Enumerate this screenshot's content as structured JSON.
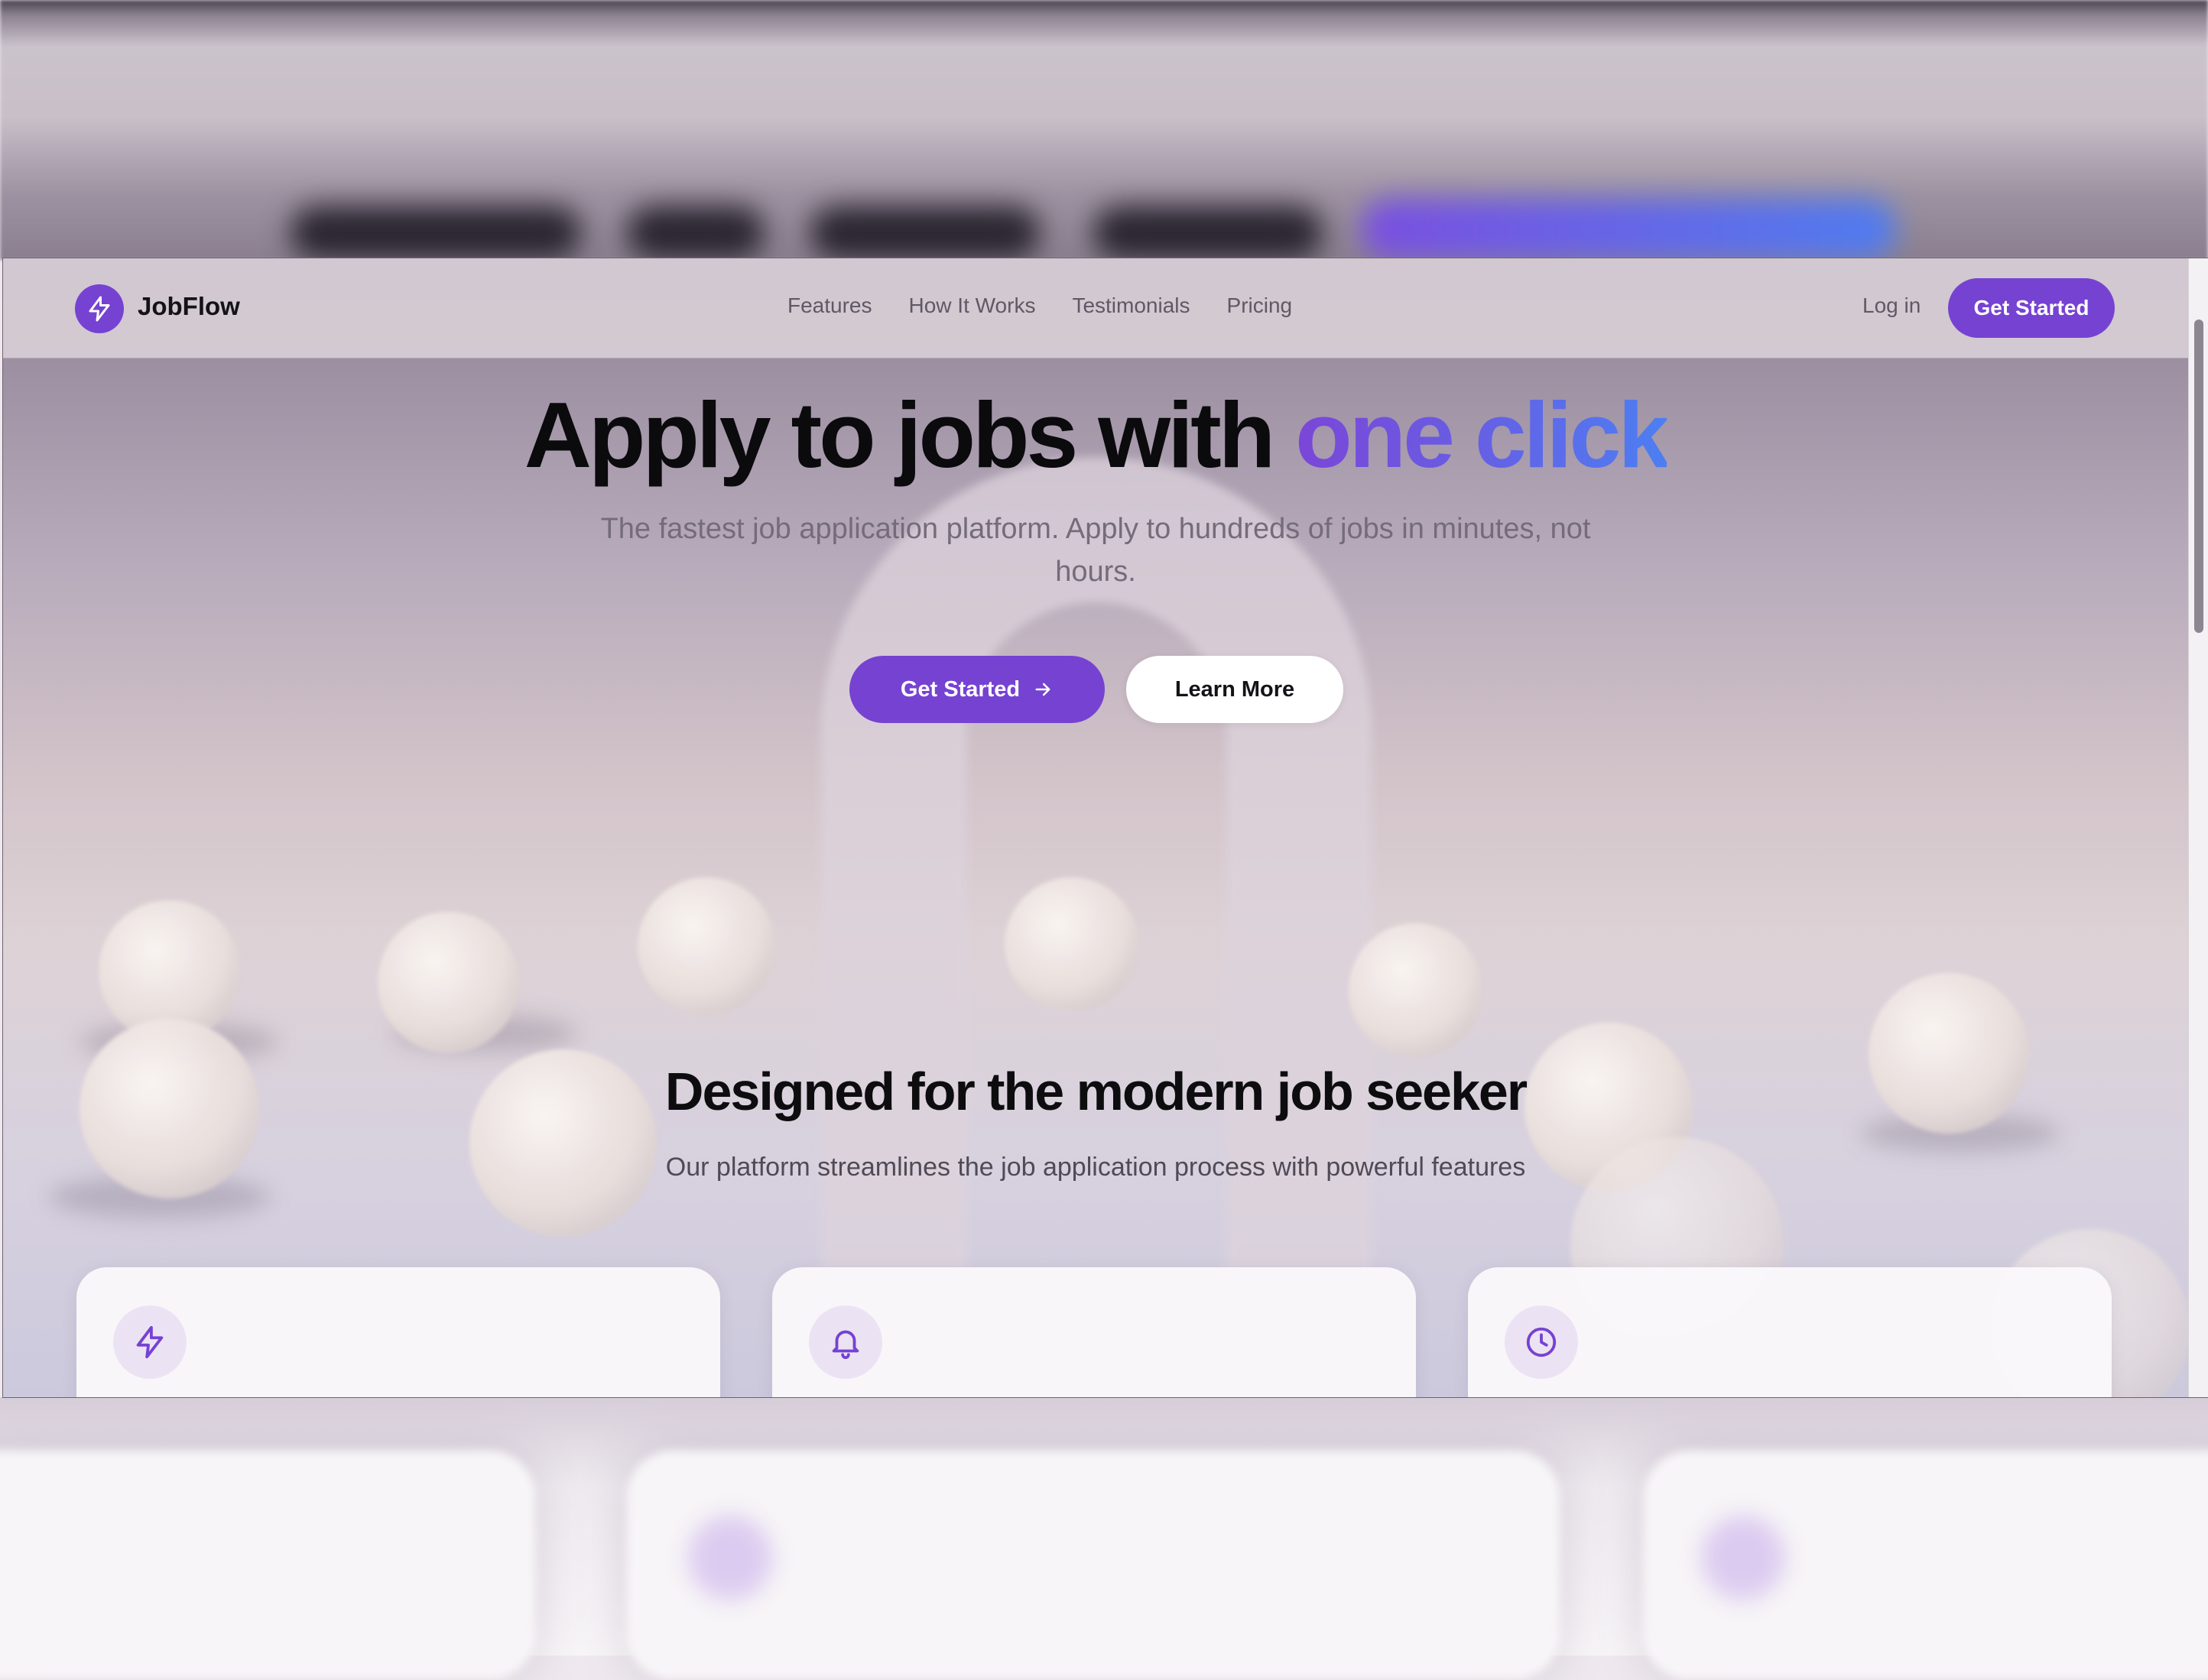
{
  "brand": {
    "name": "JobFlow",
    "color": "#7642d2",
    "icon": "bolt-icon"
  },
  "nav": {
    "links": [
      "Features",
      "How It Works",
      "Testimonials",
      "Pricing"
    ],
    "login": "Log in",
    "cta": "Get Started"
  },
  "hero": {
    "title_main": "Apply to jobs with ",
    "title_accent": "one click",
    "subtitle": "The fastest job application platform. Apply to hundreds of jobs in minutes, not hours.",
    "primary_button": "Get Started",
    "secondary_button": "Learn More"
  },
  "features": {
    "title": "Designed for the modern job seeker",
    "subtitle": "Our platform streamlines the job application process with powerful features",
    "cards": [
      {
        "icon": "bolt-icon"
      },
      {
        "icon": "bell-icon"
      },
      {
        "icon": "clock-icon"
      }
    ]
  },
  "colors": {
    "accent": "#7642d2",
    "gradient_end": "#4d7ef2",
    "text_dark": "#0b0a0c",
    "text_muted": "#746c7a"
  }
}
